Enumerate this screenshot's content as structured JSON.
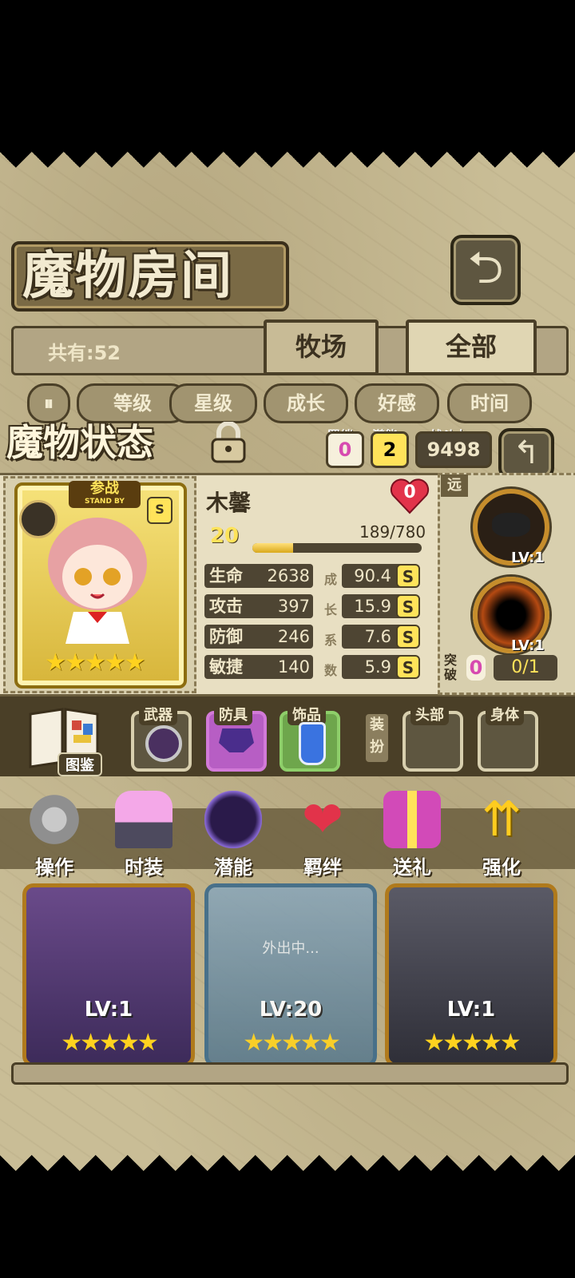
{
  "header": {
    "title": "魔物房间",
    "back_icon": "return-arrow-icon"
  },
  "top_bar": {
    "count_label": "共有:52",
    "tabs": [
      {
        "label": "牧场"
      },
      {
        "label": "全部"
      }
    ]
  },
  "sort": {
    "toggle_icon": "pause-sort-icon",
    "buttons": [
      {
        "label": "等级"
      },
      {
        "label": "星级"
      },
      {
        "label": "成长"
      },
      {
        "label": "好感"
      },
      {
        "label": "时间"
      }
    ]
  },
  "status_panel": {
    "title": "魔物状态",
    "bond": {
      "label": "羁绊",
      "value": "0"
    },
    "potential": {
      "label": "潜能",
      "value": "2"
    },
    "power": {
      "label": "战斗力",
      "value": "9498"
    },
    "badge": {
      "top": "参战",
      "sub": "STAND BY",
      "rank": "S"
    },
    "name": "木馨",
    "affection": "0",
    "level": "20",
    "exp_text": "189/780",
    "exp_fraction": 0.24,
    "stats": [
      {
        "name": "生命",
        "value": "2638",
        "growth": "90.4",
        "rank": "S"
      },
      {
        "name": "攻击",
        "value": "397",
        "growth": "15.9",
        "rank": "S"
      },
      {
        "name": "防御",
        "value": "246",
        "growth": "7.6",
        "rank": "S"
      },
      {
        "name": "敏捷",
        "value": "140",
        "growth": "5.9",
        "rank": "S"
      }
    ],
    "growth_chars": [
      "成",
      "长",
      "系",
      "数"
    ],
    "stars": "★★★★★",
    "range_label": "远",
    "skills": [
      {
        "lv": "LV:1"
      },
      {
        "lv": "LV:1"
      }
    ],
    "breakthrough": {
      "label": "突破",
      "value": "0",
      "progress": "0/1"
    }
  },
  "equipment": {
    "book_label": "图鉴",
    "slots": [
      {
        "label": "武器",
        "icon": "compass-weapon-icon",
        "color": "#d8cfae"
      },
      {
        "label": "防具",
        "icon": "crystal-armor-icon",
        "color": "#d27ad8"
      },
      {
        "label": "饰品",
        "icon": "potion-bottle-icon",
        "color": "#8ecf6a"
      },
      {
        "label": "头部",
        "icon": "",
        "color": "#d8cfae"
      },
      {
        "label": "身体",
        "icon": "",
        "color": "#d8cfae"
      }
    ],
    "unequip_label": "装扮"
  },
  "actions": [
    {
      "label": "操作",
      "icon": "gear-icon"
    },
    {
      "label": "时装",
      "icon": "outfit-icon"
    },
    {
      "label": "潜能",
      "icon": "demon-icon"
    },
    {
      "label": "羁绊",
      "icon": "hearts-icon"
    },
    {
      "label": "送礼",
      "icon": "gift-icon"
    },
    {
      "label": "强化",
      "icon": "upgrade-arrows-icon"
    }
  ],
  "cards": [
    {
      "lv": "LV:1",
      "stars": "★★★★★",
      "outing": ""
    },
    {
      "lv": "LV:20",
      "stars": "★★★★★",
      "outing": "外出中..."
    },
    {
      "lv": "LV:1",
      "stars": "★★★★★",
      "outing": ""
    }
  ]
}
